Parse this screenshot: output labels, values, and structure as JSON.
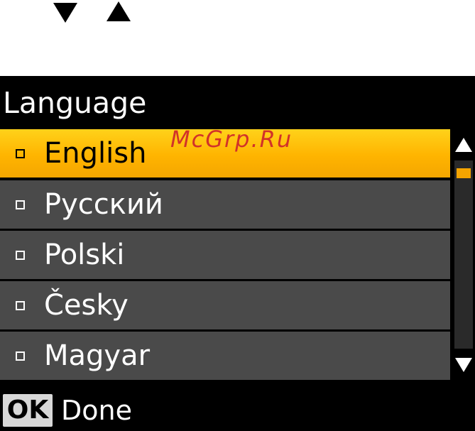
{
  "screen": {
    "title": "Language",
    "languages": [
      {
        "label": "English",
        "selected": true
      },
      {
        "label": "Русский",
        "selected": false
      },
      {
        "label": "Polski",
        "selected": false
      },
      {
        "label": "Česky",
        "selected": false
      },
      {
        "label": "Magyar",
        "selected": false
      }
    ],
    "scroll_up_icon": "triangle-up-icon",
    "scroll_down_icon": "triangle-down-icon"
  },
  "footer": {
    "ok_key": "OK",
    "ok_action": "Done"
  },
  "keys": {
    "down_icon": "triangle-down-icon",
    "up_icon": "triangle-up-icon"
  },
  "watermark": "McGrp.Ru",
  "colors": {
    "selected_highlight": "#ffbf00",
    "row_background": "#4a4a4a",
    "screen_background": "#000000",
    "watermark": "#cf2b2b"
  }
}
